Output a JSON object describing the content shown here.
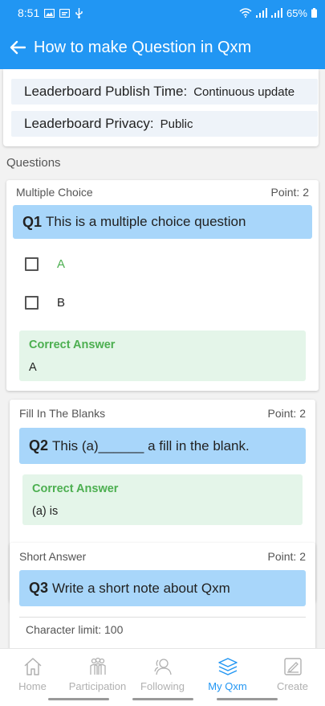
{
  "status_bar": {
    "time": "8:51",
    "battery": "65%"
  },
  "app_bar": {
    "title": "How to make Question in Qxm"
  },
  "info": {
    "publish_time_label": "Leaderboard Publish Time:",
    "publish_time_value": "Continuous update",
    "privacy_label": "Leaderboard Privacy:",
    "privacy_value": "Public"
  },
  "questions_label": "Questions",
  "questions": [
    {
      "type": "Multiple Choice",
      "point": "Point: 2",
      "number": "Q1",
      "text": "This is a multiple choice question",
      "options": [
        {
          "label": "A",
          "color": "#4caf50"
        },
        {
          "label": "B",
          "color": "#222222"
        }
      ],
      "correct_answer_label": "Correct Answer",
      "correct_answer": "A"
    },
    {
      "type": "Fill In The Blanks",
      "point": "Point: 2",
      "number": "Q2",
      "text": "This (a)______ a fill in the blank.",
      "correct_answer_label": "Correct Answer",
      "correct_answer": "(a) is"
    },
    {
      "type": "Short Answer",
      "point": "Point: 2",
      "number": "Q3",
      "text": "Write a short note about Qxm",
      "character_limit": "Character limit: 100"
    }
  ],
  "bottom_nav": [
    {
      "label": "Home",
      "icon": "home-icon",
      "active": false
    },
    {
      "label": "Participation",
      "icon": "participation-icon",
      "active": false
    },
    {
      "label": "Following",
      "icon": "following-icon",
      "active": false
    },
    {
      "label": "My Qxm",
      "icon": "layers-icon",
      "active": true
    },
    {
      "label": "Create",
      "icon": "create-icon",
      "active": false
    }
  ],
  "colors": {
    "primary": "#2196f3",
    "question_bg": "#a8d6fa",
    "answer_bg": "#e4f5e9",
    "answer_green": "#4caf50",
    "info_bg": "#eef3f9"
  }
}
